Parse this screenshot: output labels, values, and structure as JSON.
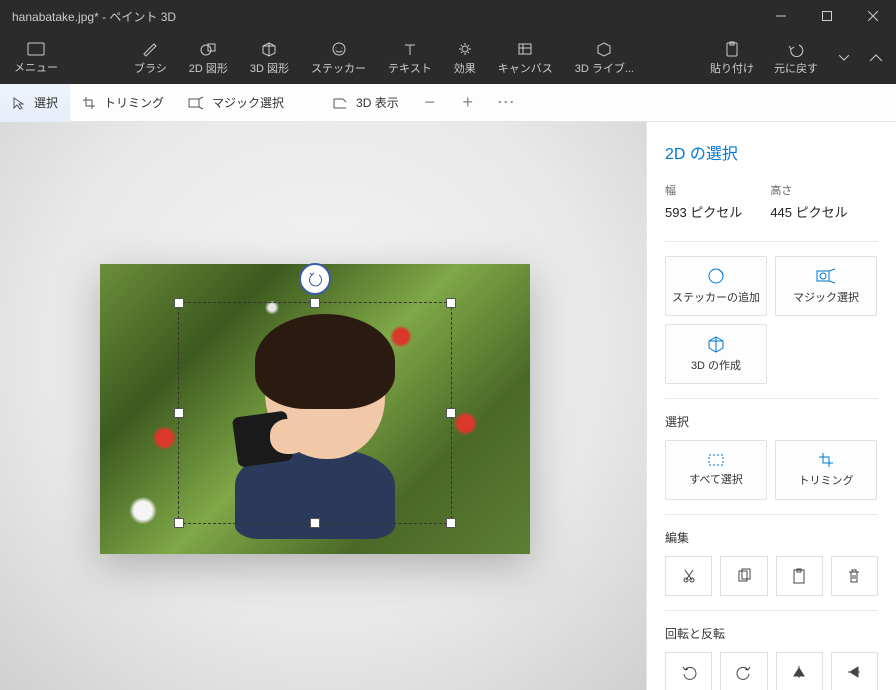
{
  "titlebar": {
    "title": "hanabatake.jpg* - ペイント 3D"
  },
  "ribbon": {
    "menu": "メニュー",
    "items": [
      "ブラシ",
      "2D 図形",
      "3D 図形",
      "ステッカー",
      "テキスト",
      "効果",
      "キャンバス",
      "3D ライブ..."
    ],
    "paste": "貼り付け",
    "undo": "元に戻す"
  },
  "toolbar": {
    "select": "選択",
    "trim": "トリミング",
    "magic": "マジック選択",
    "view3d": "3D 表示"
  },
  "side": {
    "title": "2D の選択",
    "width_label": "幅",
    "width_value": "593 ピクセル",
    "height_label": "高さ",
    "height_value": "445 ピクセル",
    "add_sticker": "ステッカーの追加",
    "magic_select": "マジック選択",
    "make_3d": "3D の作成",
    "sel_heading": "選択",
    "select_all": "すべて選択",
    "trim2": "トリミング",
    "edit_heading": "編集",
    "rotflip_heading": "回転と反転"
  }
}
